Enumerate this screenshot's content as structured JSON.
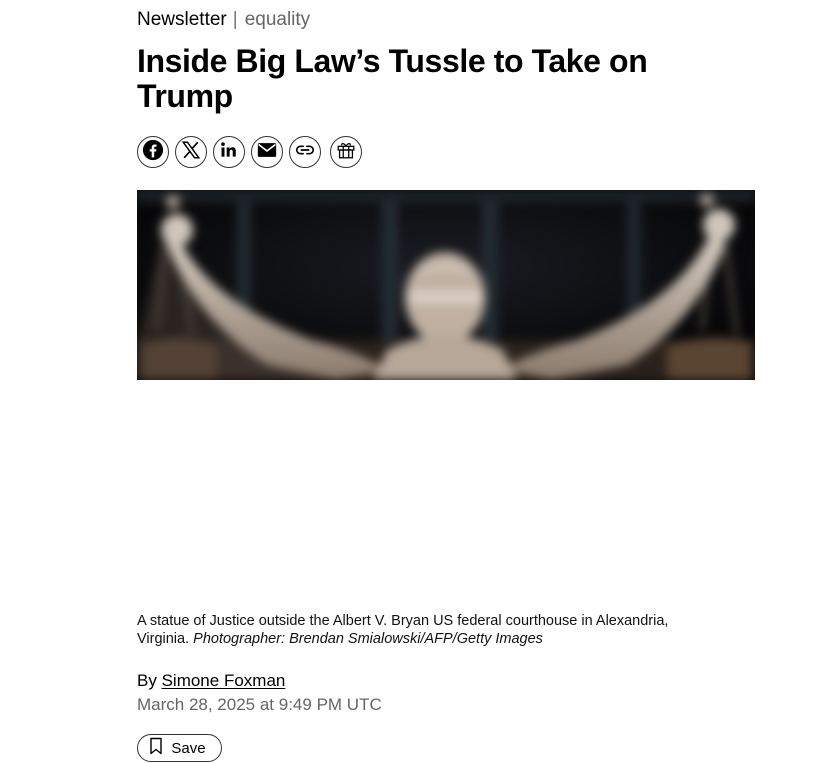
{
  "kicker": {
    "section": "Newsletter",
    "separator": "|",
    "topic": "equality"
  },
  "headline": "Inside Big Law’s Tussle to Take on Trump",
  "share_buttons": [
    {
      "icon": "facebook-icon"
    },
    {
      "icon": "x-icon"
    },
    {
      "icon": "linkedin-icon"
    },
    {
      "icon": "email-icon"
    },
    {
      "icon": "link-icon"
    },
    {
      "icon": "gift-icon"
    }
  ],
  "caption": {
    "text": "A statue of Justice outside the Albert V. Bryan US federal courthouse in Alexandria, Virginia.",
    "credit": "Photographer: Brendan Smialowski/AFP/Getty Images"
  },
  "byline": {
    "prefix": "By",
    "author": "Simone Foxman"
  },
  "date": "March 28, 2025 at 9:49 PM UTC",
  "save": {
    "label": "Save",
    "icon": "bookmark-icon"
  }
}
